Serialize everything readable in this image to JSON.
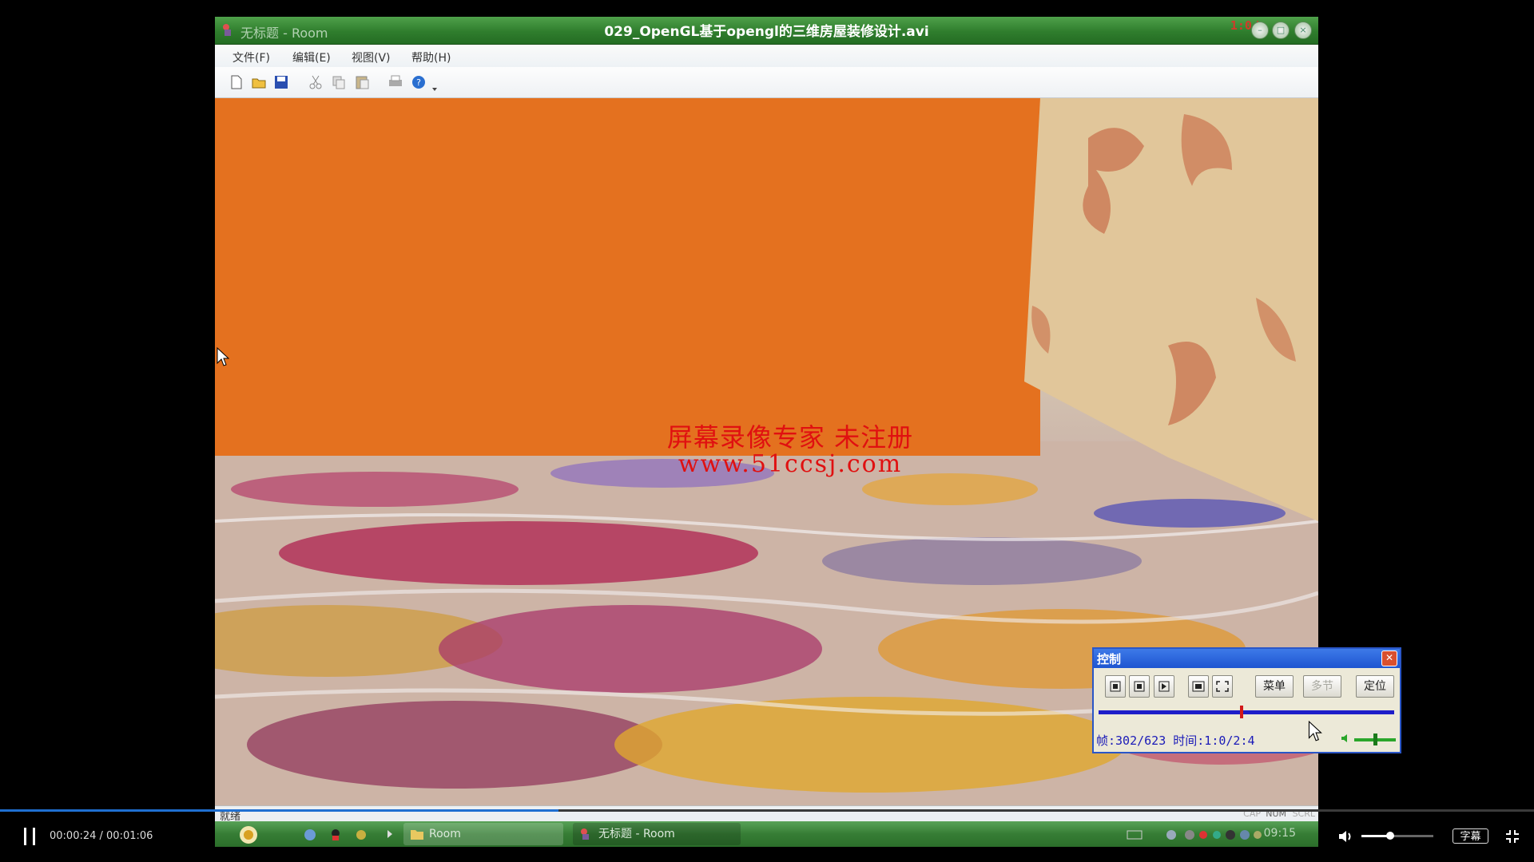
{
  "recorded_app": {
    "window_title": "无标题 - Room",
    "video_title": "029_OpenGL基于opengl的三维房屋装修设计.avi",
    "time_mark": "1:0/",
    "menu": [
      "文件(F)",
      "编辑(E)",
      "视图(V)",
      "帮助(H)"
    ],
    "status_text": "就绪",
    "status_indicators": [
      "CAP",
      "NUM",
      "SCRL"
    ],
    "taskbar": {
      "folder_task": "Room",
      "app_task": "无标题 - Room",
      "clock": "09:15"
    }
  },
  "watermark": {
    "line1": "屏幕录像专家 未注册",
    "line2": "www.51ccsj.com"
  },
  "control_panel": {
    "title": "控制",
    "buttons": [
      "菜单",
      "多节",
      "定位"
    ],
    "info": "帧:302/623 时间:1:0/2:4",
    "frame_current": 302,
    "frame_total": 623,
    "volume_level": 0.45
  },
  "player": {
    "current_time": "00:00:24",
    "total_time": "00:01:06",
    "time_display": "00:00:24 / 00:01:06",
    "progress": 0.364,
    "volume": 0.4,
    "subtitle_label": "字幕"
  },
  "colors": {
    "progress": "#1f6fd1",
    "orange_wall": "#e4711f",
    "watermark": "#e01010"
  }
}
